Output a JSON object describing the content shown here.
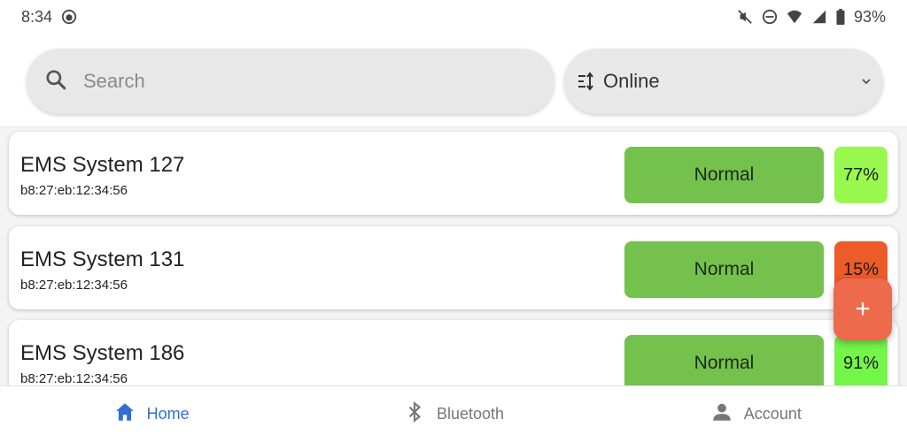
{
  "status_bar": {
    "time": "8:34",
    "battery": "93%",
    "icons": [
      "face-icon",
      "mute-icon",
      "dnd-icon",
      "wifi-icon",
      "signal-icon",
      "battery-icon"
    ]
  },
  "search": {
    "placeholder": "Search",
    "value": ""
  },
  "filter": {
    "selected": "Online"
  },
  "devices": [
    {
      "name": "EMS System 127",
      "mac": "b8:27:eb:12:34:56",
      "status": "Normal",
      "percent": "77%",
      "percent_color": "#99f84d"
    },
    {
      "name": "EMS System 131",
      "mac": "b8:27:eb:12:34:56",
      "status": "Normal",
      "percent": "15%",
      "percent_color": "#ec5b28"
    },
    {
      "name": "EMS System 186",
      "mac": "b8:27:eb:12:34:56",
      "status": "Normal",
      "percent": "91%",
      "percent_color": "#74f54a"
    }
  ],
  "fab": {
    "label": "+"
  },
  "nav": {
    "items": [
      {
        "label": "Home",
        "icon": "home-icon",
        "active": true
      },
      {
        "label": "Bluetooth",
        "icon": "bluetooth-icon",
        "active": false
      },
      {
        "label": "Account",
        "icon": "account-icon",
        "active": false
      }
    ]
  },
  "colors": {
    "status_normal": "#74c14e",
    "accent": "#2f6fd6",
    "fab": "#ed6a4c"
  }
}
